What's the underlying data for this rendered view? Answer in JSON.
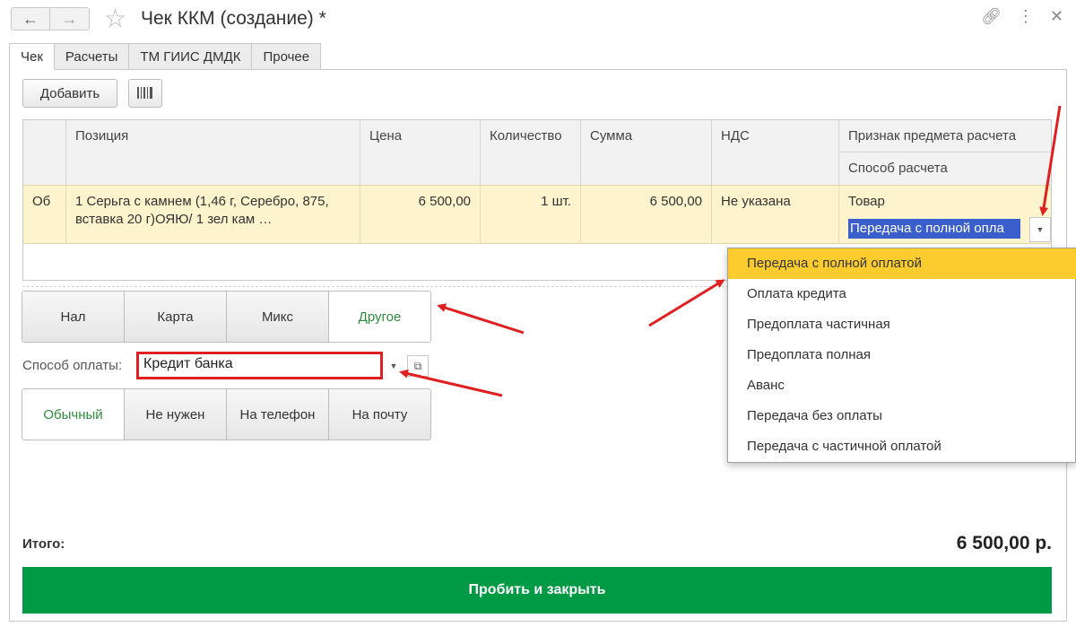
{
  "window": {
    "title": "Чек ККМ (создание) *",
    "back_icon": "arrow-left-icon",
    "forward_icon": "arrow-right-icon",
    "favorite_icon": "star-icon",
    "link_icon": "link-icon",
    "more_icon": "more-vertical-icon",
    "close_icon": "close-icon"
  },
  "tabs": [
    {
      "label": "Чек",
      "active": true
    },
    {
      "label": "Расчеты",
      "active": false
    },
    {
      "label": "ТМ ГИИС ДМДК",
      "active": false
    },
    {
      "label": "Прочее",
      "active": false
    }
  ],
  "toolbar": {
    "add_label": "Добавить",
    "barcode_icon": "barcode-scan-icon"
  },
  "table": {
    "headers": {
      "position": "Позиция",
      "price": "Цена",
      "quantity": "Количество",
      "sum": "Сумма",
      "vat": "НДС",
      "subject": "Признак предмета расчета",
      "method": "Способ расчета"
    },
    "rows": [
      {
        "code": "Об",
        "position": "1 Серьга с камнем (1,46 г, Серебро, 875, вставка 20 г)ОЯЮ/ 1 зел кам …",
        "price": "6 500,00",
        "quantity": "1 шт.",
        "sum": "6 500,00",
        "vat": "Не указана",
        "subject": "Товар",
        "method": "Передача с полной опла"
      }
    ]
  },
  "payment_types": [
    "Нал",
    "Карта",
    "Микс",
    "Другое"
  ],
  "payment_type_active": "Другое",
  "payment_method": {
    "label": "Способ оплаты:",
    "value": "Кредит банка"
  },
  "send_options": [
    "Обычный",
    "Не нужен",
    "На телефон",
    "На почту"
  ],
  "send_option_active": "Обычный",
  "totals": {
    "label": "Итого:",
    "value": "6 500,00 р."
  },
  "submit_label": "Пробить и закрыть",
  "dropdown": {
    "selected": "Передача с полной оплатой",
    "options": [
      "Передача с полной оплатой",
      "Оплата кредита",
      "Предоплата частичная",
      "Предоплата полная",
      "Аванс",
      "Передача без оплаты",
      "Передача с частичной оплатой"
    ]
  },
  "colors": {
    "accent_green": "#009a45",
    "row_highlight": "#fdf3cc",
    "dropdown_highlight": "#fccc2e",
    "annotation_red": "#e02020"
  }
}
